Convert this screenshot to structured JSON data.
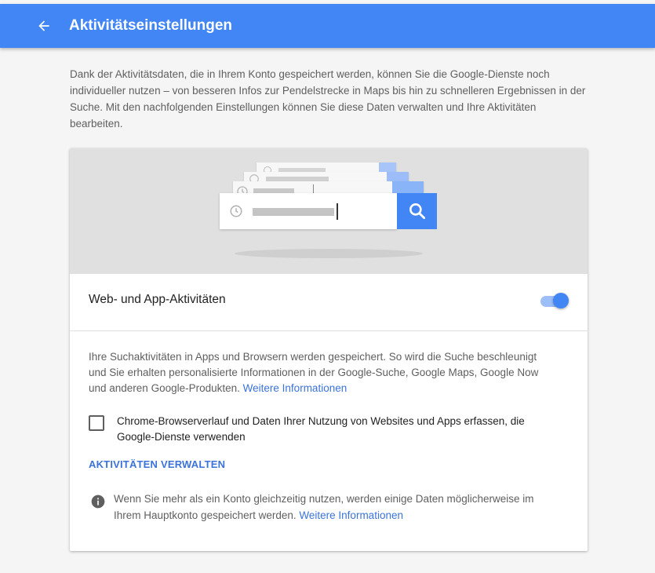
{
  "header": {
    "title": "Aktivitätseinstellungen",
    "back_icon": "arrow-left-icon",
    "bg_color": "#4285f4"
  },
  "intro": {
    "text": "Dank der Aktivitätsdaten, die in Ihrem Konto gespeichert werden, können Sie die Google-Dienste noch individueller nutzen – von besseren Infos zur Pendelstrecke in Maps bis hin zu schnelleren Ergebnissen in der Suche. Mit den nachfolgenden Einstellungen können Sie diese Daten verwalten und Ihre Aktivitäten bearbeiten."
  },
  "card": {
    "hero": {
      "icons": [
        "clock-icon",
        "search-icon"
      ]
    },
    "toggle": {
      "label": "Web- und App-Aktivitäten",
      "state": "on",
      "accent": "#4285f4"
    },
    "description": {
      "text": "Ihre Suchaktivitäten in Apps und Browsern werden gespeichert. So wird die Suche beschleunigt und Sie erhalten personalisierte Informationen in der Google-Suche, Google Maps, Google Now und anderen Google-Produkten.",
      "link": "Weitere Informationen"
    },
    "checkbox": {
      "label": "Chrome-Browserverlauf und Daten Ihrer Nutzung von Websites und Apps erfassen, die Google-Dienste verwenden",
      "checked": false
    },
    "manage_label": "AKTIVITÄTEN VERWALTEN",
    "info": {
      "icon": "info-icon",
      "text": "Wenn Sie mehr als ein Konto gleichzeitig nutzen, werden einige Daten möglicherweise im Ihrem Hauptkonto gespeichert werden.",
      "link": "Weitere Informationen"
    },
    "link_color": "#3b73d9"
  }
}
